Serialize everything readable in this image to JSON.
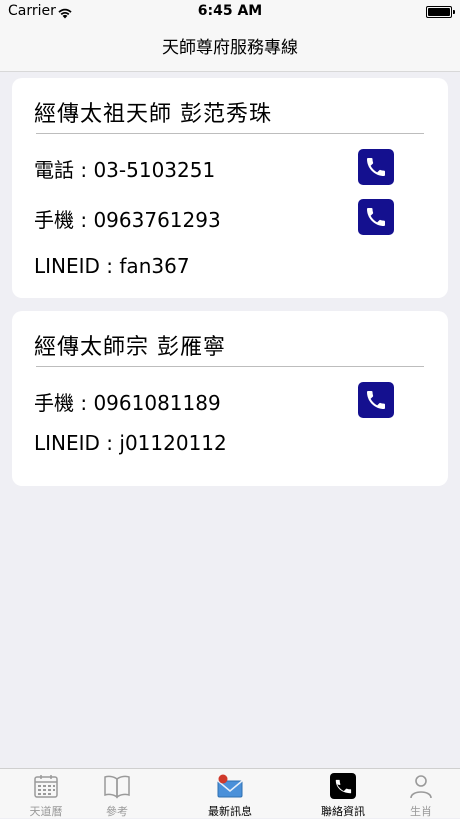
{
  "status_bar": {
    "carrier": "Carrier",
    "time": "6:45 AM"
  },
  "nav": {
    "title": "天師尊府服務專線"
  },
  "contacts": [
    {
      "title": "經傳太祖天師  彭范秀珠",
      "rows": [
        {
          "label": "電話 : 03-5103251",
          "callable": true
        },
        {
          "label": "手機 : 0963761293",
          "callable": true
        },
        {
          "label": "LINEID : fan367",
          "callable": false
        }
      ]
    },
    {
      "title": "經傳太師宗  彭雁寧",
      "rows": [
        {
          "label": "手機 : 0961081189",
          "callable": true
        },
        {
          "label": "LINEID : j01120112",
          "callable": false
        }
      ]
    }
  ],
  "tabs": [
    {
      "label": "天道曆",
      "icon": "calendar-icon"
    },
    {
      "label": "參考",
      "icon": "book-icon"
    },
    {
      "label": "最新訊息",
      "icon": "mail-icon"
    },
    {
      "label": "聯絡資訊",
      "icon": "phone-icon"
    },
    {
      "label": "生肖",
      "icon": "person-icon"
    }
  ],
  "colors": {
    "call_button": "#14108f",
    "background": "#efeff4",
    "tab_active": "#000000",
    "tab_inactive": "#9a9a9a"
  }
}
